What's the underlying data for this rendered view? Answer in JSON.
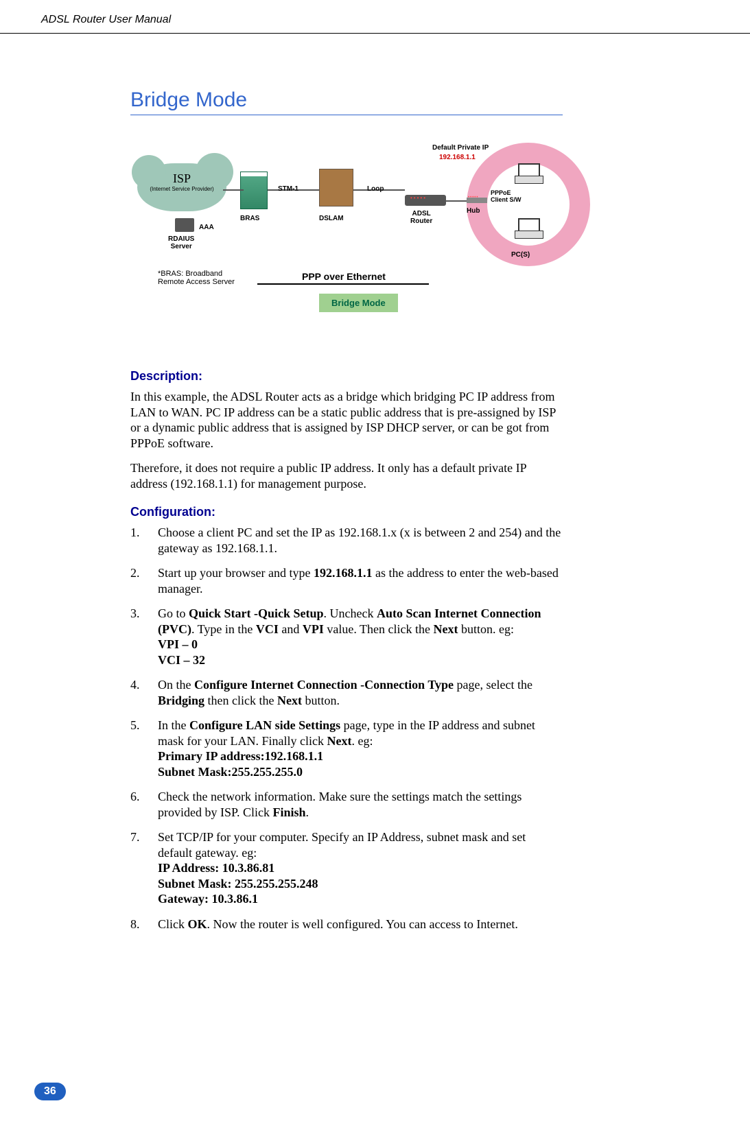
{
  "header": "ADSL Router User Manual",
  "title": "Bridge Mode",
  "diagram": {
    "default_ip_label": "Default Private IP",
    "default_ip_value": "192.168.1.1",
    "isp": "ISP",
    "isp_sub": "(Internet Service Provider)",
    "aaa": "AAA",
    "rdaius_server": "RDAIUS\nServer",
    "stm1": "STM-1",
    "loop": "Loop",
    "bras": "BRAS",
    "dslam": "DSLAM",
    "adsl_router": "ADSL\nRouter",
    "hub": "Hub",
    "pppoe": "PPPoE\nClient S/W",
    "pcs": "PC(S)",
    "bras_note": "*BRAS: Broadband\nRemote Access Server",
    "ppp_eth": "PPP over Ethernet",
    "bridge_mode": "Bridge Mode"
  },
  "description_heading": "Description:",
  "description_p1": "In this example, the ADSL Router acts as a bridge which bridging PC IP address from LAN to WAN. PC IP address can be a static public address that is pre-assigned by ISP or a dynamic public address that is assigned by ISP DHCP server, or can be got from PPPoE software.",
  "description_p2": "Therefore, it does not require a public IP address. It only has a default private IP address (192.168.1.1) for management purpose.",
  "configuration_heading": "Configuration:",
  "steps": [
    {
      "num": "1.",
      "text_parts": [
        {
          "t": "Choose a client PC and set the IP as 192.168.1.x (x is between 2 and 254) and the gateway as 192.168.1.1."
        }
      ]
    },
    {
      "num": "2.",
      "text_parts": [
        {
          "t": "Start up your browser and type "
        },
        {
          "t": "192.168.1.1",
          "b": true
        },
        {
          "t": " as the address to enter the web-based manager."
        }
      ]
    },
    {
      "num": "3.",
      "text_parts": [
        {
          "t": "Go to "
        },
        {
          "t": "Quick Start -Quick Setup",
          "b": true
        },
        {
          "t": ". Uncheck "
        },
        {
          "t": "Auto Scan Internet Connection (PVC)",
          "b": true
        },
        {
          "t": ". Type in the "
        },
        {
          "t": "VCI",
          "b": true
        },
        {
          "t": " and "
        },
        {
          "t": "VPI",
          "b": true
        },
        {
          "t": " value. Then click the "
        },
        {
          "t": "Next",
          "b": true
        },
        {
          "t": " button. eg:"
        },
        {
          "br": true
        },
        {
          "t": "VPI – 0",
          "b": true
        },
        {
          "br": true
        },
        {
          "t": "VCI – 32",
          "b": true
        }
      ]
    },
    {
      "num": "4.",
      "text_parts": [
        {
          "t": "On the "
        },
        {
          "t": "Configure Internet Connection -Connection Type",
          "b": true
        },
        {
          "t": " page, select the "
        },
        {
          "t": "Bridging",
          "b": true
        },
        {
          "t": " then click the "
        },
        {
          "t": "Next",
          "b": true
        },
        {
          "t": " button."
        }
      ]
    },
    {
      "num": "5.",
      "text_parts": [
        {
          "t": "In the "
        },
        {
          "t": "Configure LAN side Settings",
          "b": true
        },
        {
          "t": " page, type in the IP address and subnet mask for your LAN. Finally click "
        },
        {
          "t": "Next",
          "b": true
        },
        {
          "t": ". eg:"
        },
        {
          "br": true
        },
        {
          "t": "Primary IP address:192.168.1.1",
          "b": true
        },
        {
          "br": true
        },
        {
          "t": "Subnet Mask:255.255.255.0",
          "b": true
        }
      ]
    },
    {
      "num": "6.",
      "text_parts": [
        {
          "t": "Check the network information. Make sure the settings match the settings provided by ISP. Click "
        },
        {
          "t": "Finish",
          "b": true
        },
        {
          "t": "."
        }
      ]
    },
    {
      "num": "7.",
      "text_parts": [
        {
          "t": "Set TCP/IP for your computer. Specify an IP Address, subnet mask and set default gateway. eg:"
        },
        {
          "br": true
        },
        {
          "t": "IP Address: 10.3.86.81",
          "b": true
        },
        {
          "br": true
        },
        {
          "t": "Subnet Mask: 255.255.255.248",
          "b": true
        },
        {
          "br": true
        },
        {
          "t": "Gateway: 10.3.86.1",
          "b": true
        }
      ]
    },
    {
      "num": "8.",
      "text_parts": [
        {
          "t": "Click "
        },
        {
          "t": "OK",
          "b": true
        },
        {
          "t": ". Now the router is well configured. You can access to Internet."
        }
      ]
    }
  ],
  "page_number": "36"
}
